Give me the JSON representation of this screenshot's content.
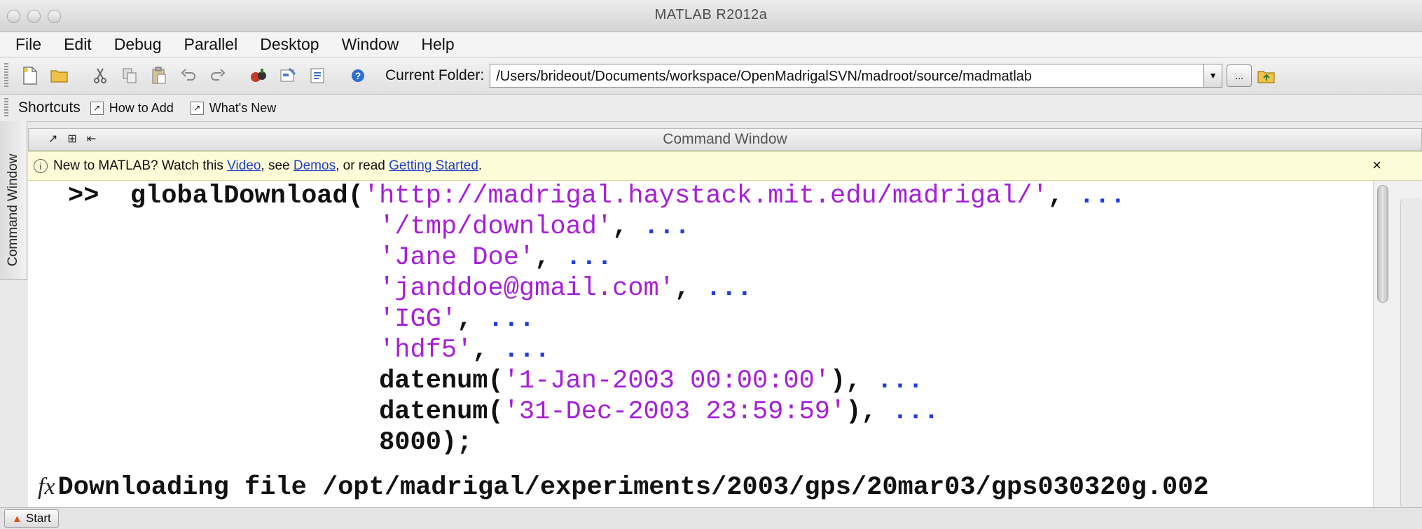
{
  "window": {
    "title": "MATLAB  R2012a"
  },
  "menubar": {
    "items": [
      "File",
      "Edit",
      "Debug",
      "Parallel",
      "Desktop",
      "Window",
      "Help"
    ]
  },
  "toolbar": {
    "current_folder_label": "Current Folder:",
    "current_folder_path": "/Users/brideout/Documents/workspace/OpenMadrigalSVN/madroot/source/madmatlab",
    "browse_label": "..."
  },
  "shortcuts": {
    "label": "Shortcuts",
    "items": [
      "How to Add",
      "What's New"
    ]
  },
  "sidebar": {
    "tab_label": "Command Window"
  },
  "command_window": {
    "title": "Command Window",
    "notice": {
      "prefix": "New to MATLAB? Watch this ",
      "video_link": "Video",
      "mid1": ", see ",
      "demos_link": "Demos",
      "mid2": ", or read ",
      "getting_started_link": "Getting Started",
      "suffix": ".",
      "close": "×"
    },
    "prompt": ">>",
    "lines": [
      {
        "code": "globalDownload(",
        "str": "'http://madrigal.haystack.mit.edu/madrigal/'",
        "tail": ", ",
        "cont": "..."
      },
      {
        "code": "",
        "str": "'/tmp/download'",
        "tail": ", ",
        "cont": "..."
      },
      {
        "code": "",
        "str": "'Jane Doe'",
        "tail": ", ",
        "cont": "..."
      },
      {
        "code": "",
        "str": "'janddoe@gmail.com'",
        "tail": ", ",
        "cont": "..."
      },
      {
        "code": "",
        "str": "'IGG'",
        "tail": ", ",
        "cont": "..."
      },
      {
        "code": "",
        "str": "'hdf5'",
        "tail": ", ",
        "cont": "..."
      },
      {
        "code": "datenum(",
        "str": "'1-Jan-2003 00:00:00'",
        "tail": "), ",
        "cont": "..."
      },
      {
        "code": "datenum(",
        "str": "'31-Dec-2003 23:59:59'",
        "tail": "), ",
        "cont": "..."
      },
      {
        "code": "8000);",
        "str": "",
        "tail": "",
        "cont": ""
      }
    ],
    "fx_symbol": "fx",
    "output": "Downloading file /opt/madrigal/experiments/2003/gps/20mar03/gps030320g.002"
  },
  "statusbar": {
    "start_label": "Start"
  }
}
